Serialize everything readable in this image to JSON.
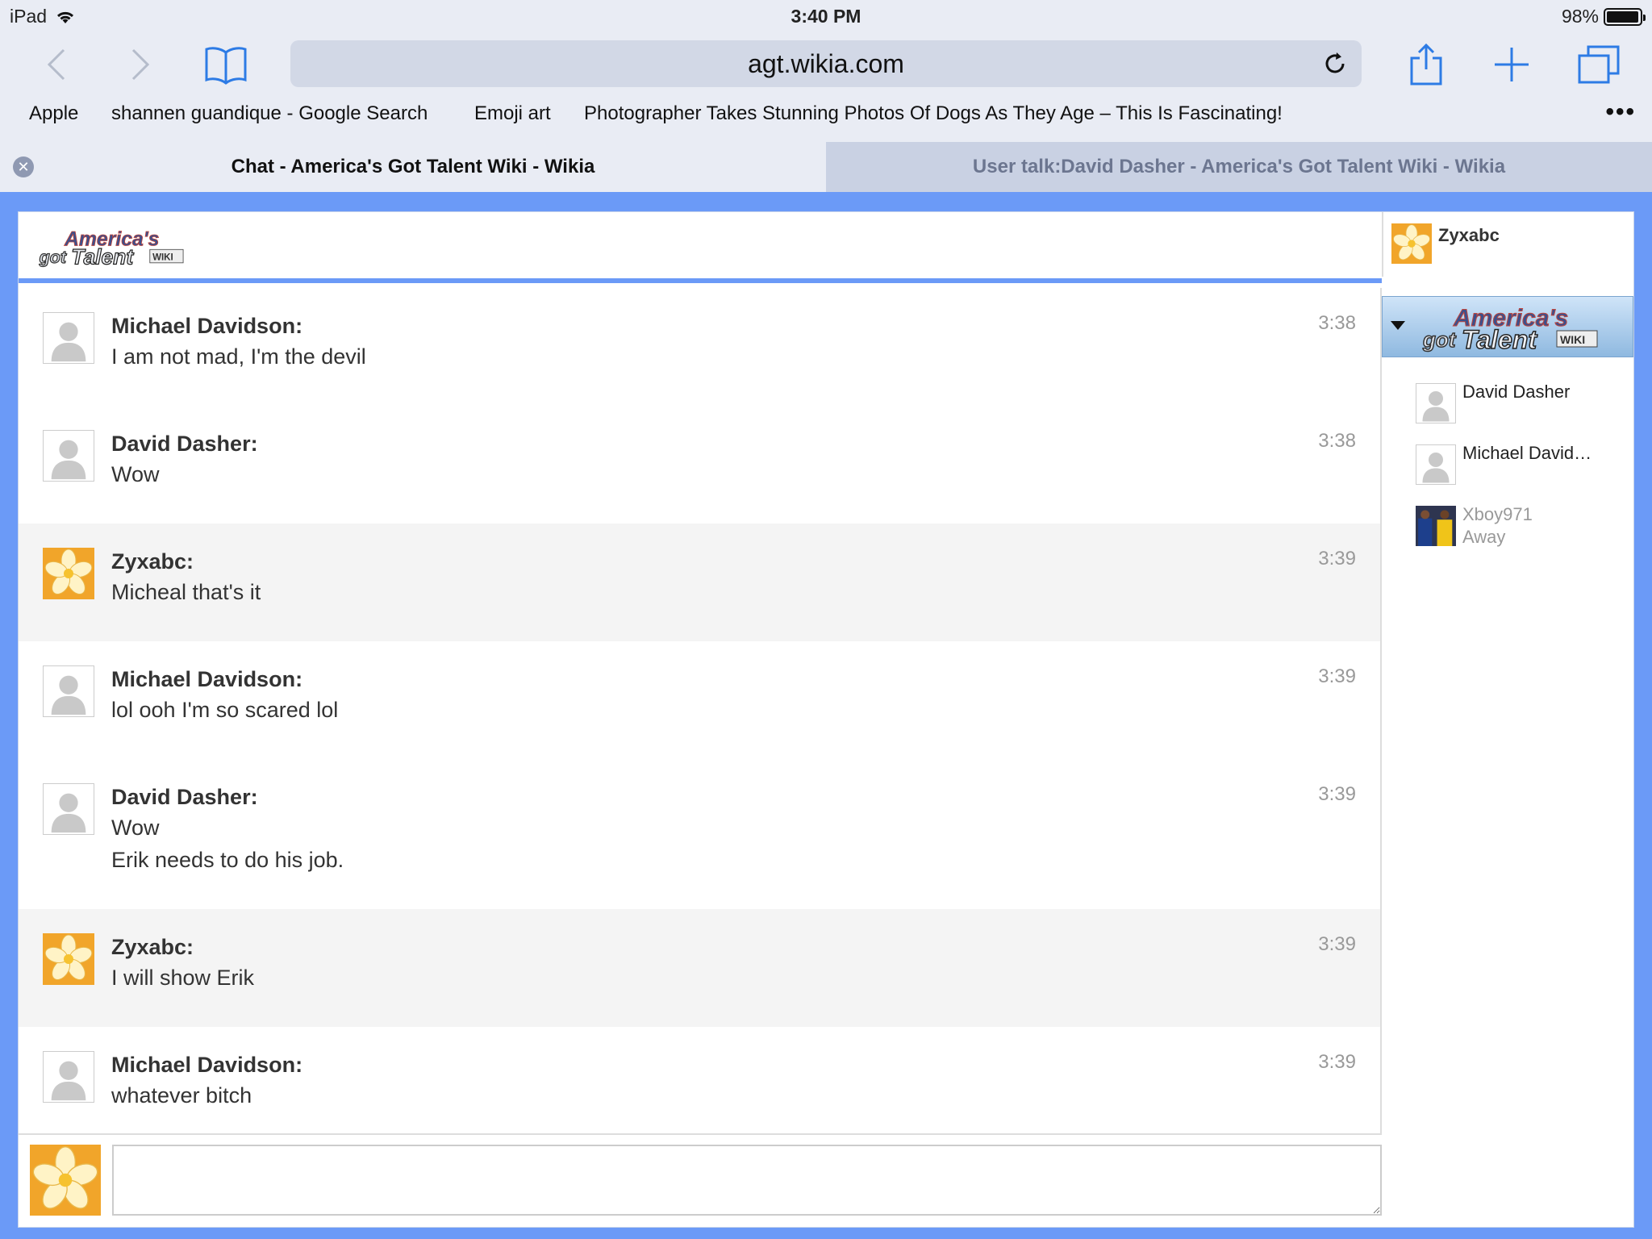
{
  "status_bar": {
    "device": "iPad",
    "time": "3:40 PM",
    "battery": "98%",
    "battery_level": 0.98
  },
  "toolbar": {
    "url": "agt.wikia.com"
  },
  "bookmarks": [
    "Apple",
    "shannen guandique - Google Search",
    "Emoji art",
    "Photographer Takes Stunning Photos Of Dogs As They Age – This Is Fascinating!"
  ],
  "tabs": [
    {
      "title": "Chat - America's Got Talent Wiki - Wikia",
      "active": true
    },
    {
      "title": "User talk:David Dasher - America's Got Talent Wiki - Wikia",
      "active": false
    }
  ],
  "chat": {
    "logo_text": "America's Got Talent WIKI",
    "current_user": "Zyxabc",
    "messages": [
      {
        "author": "Michael Davidson:",
        "lines": [
          "I am not mad, I'm the devil"
        ],
        "time": "3:38",
        "avatar": "silhouette"
      },
      {
        "author": "David Dasher:",
        "lines": [
          "Wow"
        ],
        "time": "3:38",
        "avatar": "silhouette"
      },
      {
        "author": "Zyxabc:",
        "lines": [
          "Micheal that's it"
        ],
        "time": "3:39",
        "avatar": "flower"
      },
      {
        "author": "Michael Davidson:",
        "lines": [
          "lol ooh I'm so scared lol"
        ],
        "time": "3:39",
        "avatar": "silhouette"
      },
      {
        "author": "David Dasher:",
        "lines": [
          "Wow",
          "Erik needs to do his job."
        ],
        "time": "3:39",
        "avatar": "silhouette"
      },
      {
        "author": "Zyxabc:",
        "lines": [
          "I will show Erik"
        ],
        "time": "3:39",
        "avatar": "flower"
      },
      {
        "author": "Michael Davidson:",
        "lines": [
          "whatever bitch"
        ],
        "time": "3:39",
        "avatar": "silhouette"
      }
    ],
    "users": [
      {
        "name": "David Dasher",
        "status": "",
        "avatar": "silhouette"
      },
      {
        "name": "Michael David…",
        "status": "",
        "avatar": "silhouette"
      },
      {
        "name": "Xboy971",
        "status": "Away",
        "avatar": "photo"
      }
    ],
    "compose_value": ""
  },
  "colors": {
    "page_background": "#6b9af7",
    "alt_row": "#f4f4f4",
    "accent": "#2d7be5"
  }
}
